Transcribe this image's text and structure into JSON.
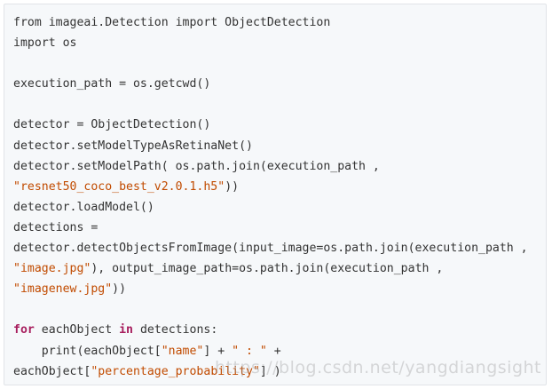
{
  "code": {
    "lines": [
      [
        {
          "t": "from imageai.Detection import ObjectDetection",
          "c": "pl"
        }
      ],
      [
        {
          "t": "import os",
          "c": "pl"
        }
      ],
      [],
      [
        {
          "t": "execution_path = os.getcwd()",
          "c": "pl"
        }
      ],
      [],
      [
        {
          "t": "detector = ObjectDetection()",
          "c": "pl"
        }
      ],
      [
        {
          "t": "detector.setModelTypeAsRetinaNet()",
          "c": "pl"
        }
      ],
      [
        {
          "t": "detector.setModelPath( os.path.join(execution_path ,",
          "c": "pl"
        }
      ],
      [
        {
          "t": "\"resnet50_coco_best_v2.0.1.h5\"",
          "c": "str"
        },
        {
          "t": "))",
          "c": "pl"
        }
      ],
      [
        {
          "t": "detector.loadModel()",
          "c": "pl"
        }
      ],
      [
        {
          "t": "detections =",
          "c": "pl"
        }
      ],
      [
        {
          "t": "detector.detectObjectsFromImage(input_image=os.path.join(execution_path ,",
          "c": "pl"
        }
      ],
      [
        {
          "t": "\"image.jpg\"",
          "c": "str"
        },
        {
          "t": "), output_image_path=os.path.join(execution_path ,",
          "c": "pl"
        }
      ],
      [
        {
          "t": "\"imagenew.jpg\"",
          "c": "str"
        },
        {
          "t": "))",
          "c": "pl"
        }
      ],
      [],
      [
        {
          "t": "for",
          "c": "kw"
        },
        {
          "t": " eachObject ",
          "c": "pl"
        },
        {
          "t": "in",
          "c": "kw"
        },
        {
          "t": " detections:",
          "c": "pl"
        }
      ],
      [
        {
          "t": "    print(eachObject[",
          "c": "pl"
        },
        {
          "t": "\"name\"",
          "c": "str"
        },
        {
          "t": "] + ",
          "c": "pl"
        },
        {
          "t": "\" : \"",
          "c": "str"
        },
        {
          "t": " +",
          "c": "pl"
        }
      ],
      [
        {
          "t": "eachObject[",
          "c": "pl"
        },
        {
          "t": "\"percentage_probability\"",
          "c": "str"
        },
        {
          "t": "] )",
          "c": "pl"
        }
      ]
    ]
  },
  "watermark": {
    "text": "https://blog.csdn.net/yangdiangsight"
  },
  "colors": {
    "background": "#f6f8fa",
    "border": "#e1e4e8",
    "text": "#333333",
    "string": "#c14b00",
    "keyword": "#a71d5d"
  }
}
